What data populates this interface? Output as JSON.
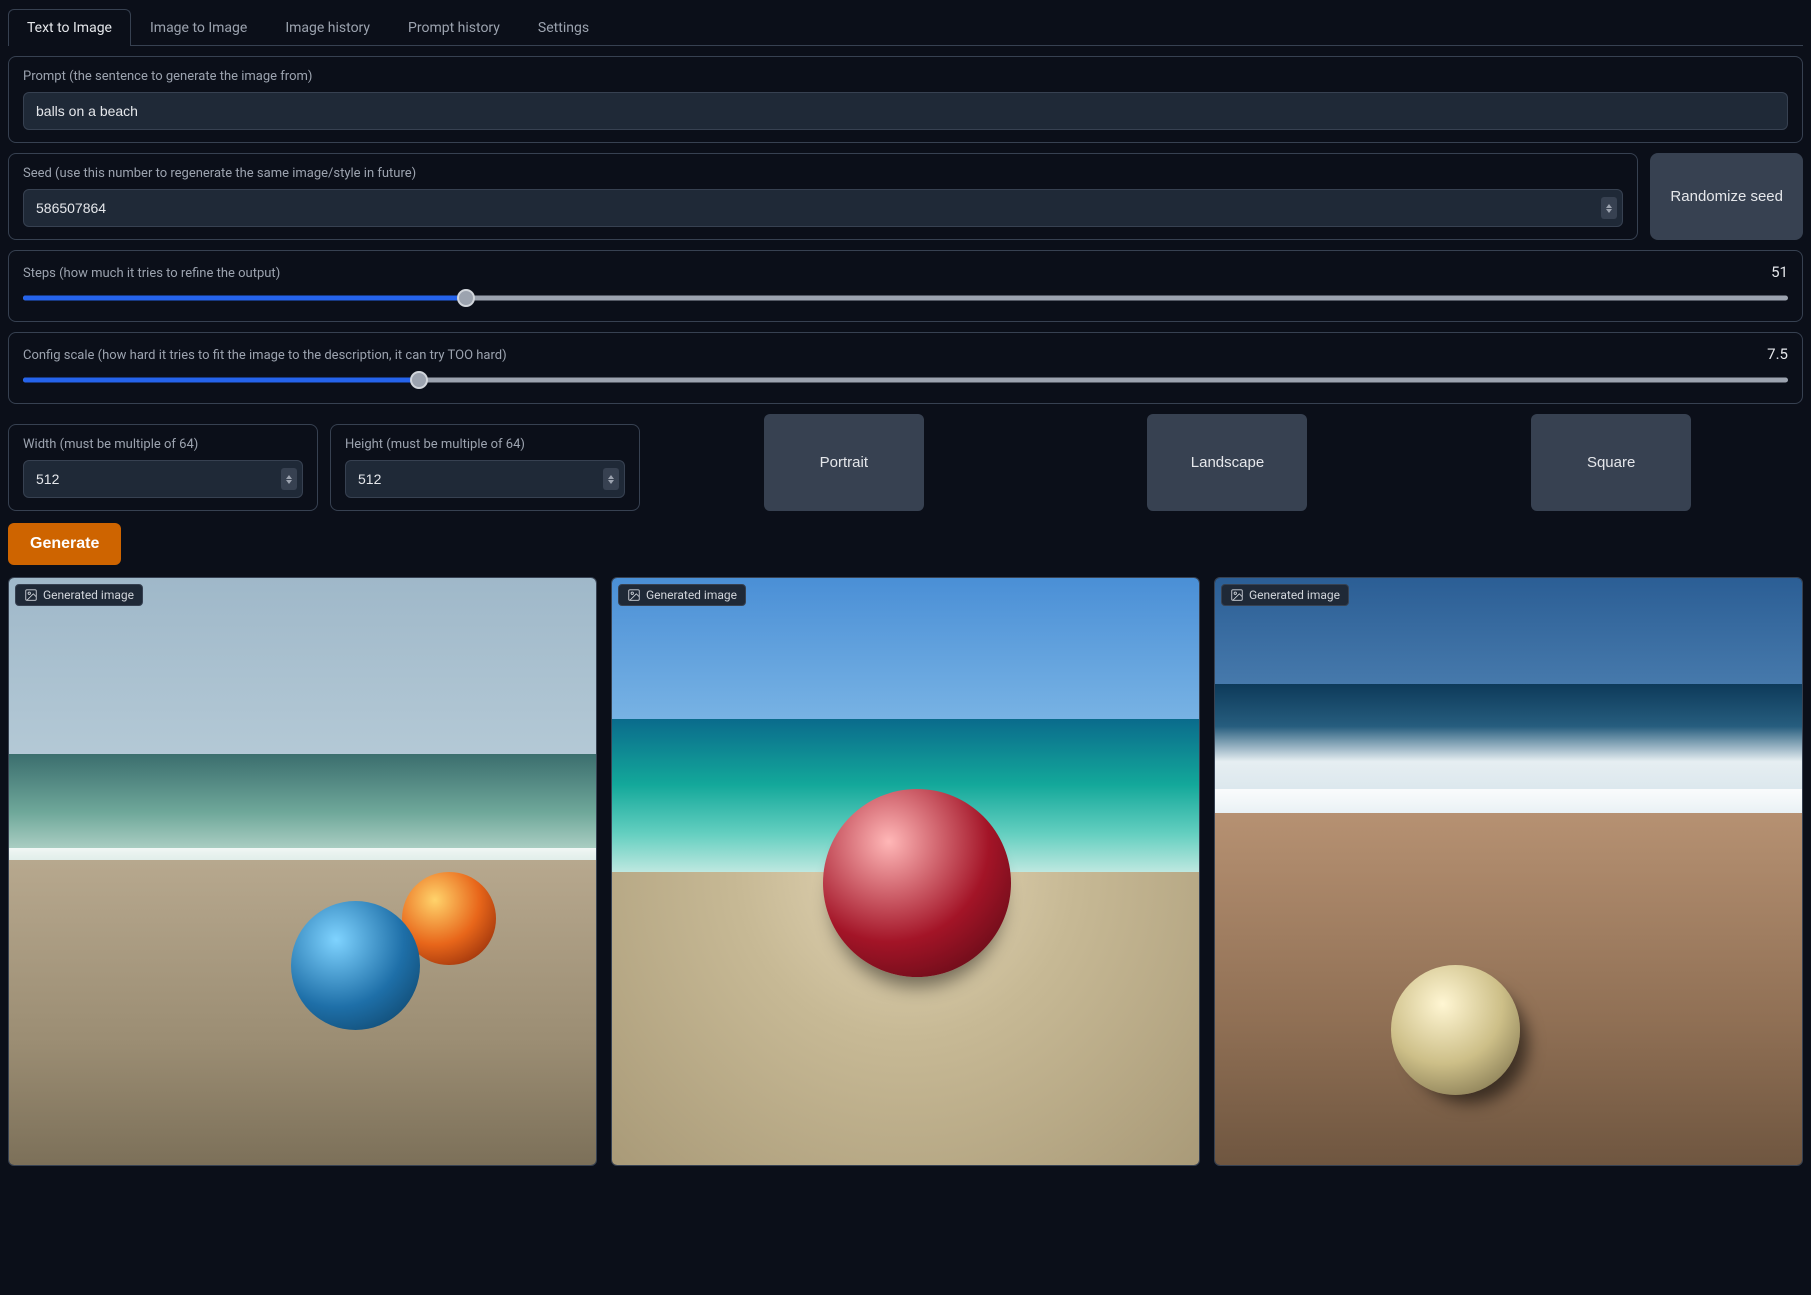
{
  "tabs": [
    {
      "label": "Text to Image",
      "active": true
    },
    {
      "label": "Image to Image"
    },
    {
      "label": "Image history"
    },
    {
      "label": "Prompt history"
    },
    {
      "label": "Settings"
    }
  ],
  "prompt": {
    "label": "Prompt (the sentence to generate the image from)",
    "value": "balls on a beach"
  },
  "seed": {
    "label": "Seed (use this number to regenerate the same image/style in future)",
    "value": "586507864",
    "randomize_label": "Randomize seed"
  },
  "steps": {
    "label": "Steps (how much it tries to refine the output)",
    "value": 51,
    "min": 1,
    "max": 200
  },
  "config_scale": {
    "label": "Config scale (how hard it tries to fit the image to the description, it can try TOO hard)",
    "value": 7.5,
    "min": 1,
    "max": 30
  },
  "width": {
    "label": "Width (must be multiple of 64)",
    "value": "512"
  },
  "height": {
    "label": "Height (must be multiple of 64)",
    "value": "512"
  },
  "aspect_buttons": {
    "portrait": "Portrait",
    "landscape": "Landscape",
    "square": "Square"
  },
  "generate_label": "Generate",
  "gallery": {
    "badge_label": "Generated image",
    "items": [
      {
        "caption": "Generated image"
      },
      {
        "caption": "Generated image"
      },
      {
        "caption": "Generated image"
      }
    ]
  }
}
